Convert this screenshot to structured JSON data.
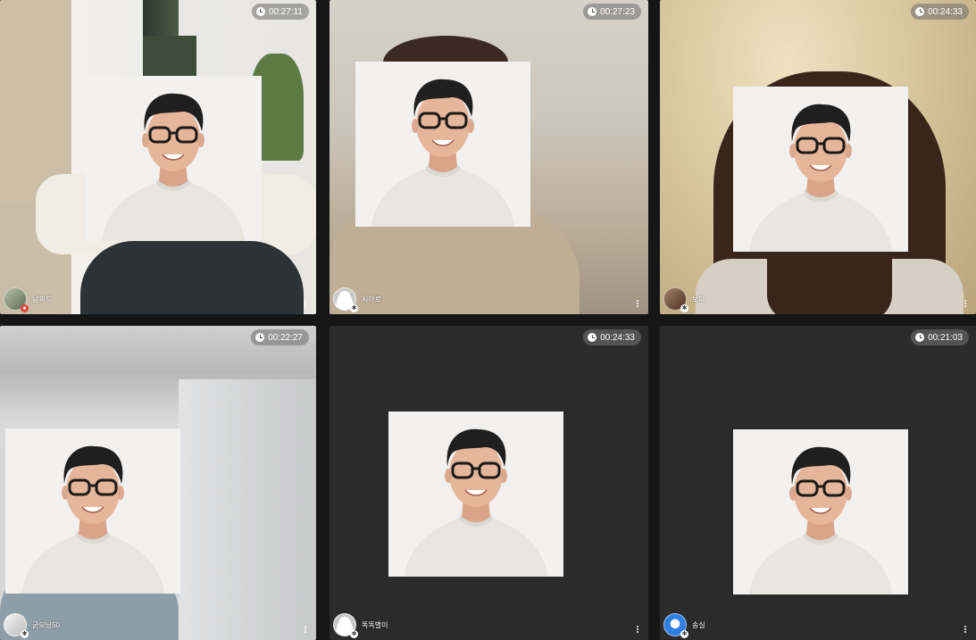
{
  "tiles": [
    {
      "id": "tile-1",
      "timer": "00:27:11",
      "name": "탐짜드",
      "avatar_icon": "user-photo-icon"
    },
    {
      "id": "tile-2",
      "timer": "00:27:23",
      "name": "시아로",
      "avatar_icon": "default-user-icon"
    },
    {
      "id": "tile-3",
      "timer": "00:24:33",
      "name": "보다",
      "avatar_icon": "user-photo-icon"
    },
    {
      "id": "tile-4",
      "timer": "00:22:27",
      "name": "굳모닝50",
      "avatar_icon": "user-photo-icon"
    },
    {
      "id": "tile-5",
      "timer": "00:24:33",
      "name": "똑똑별이",
      "avatar_icon": "default-user-icon"
    },
    {
      "id": "tile-6",
      "timer": "00:21:03",
      "name": "송실",
      "avatar_icon": "user-photo-icon"
    }
  ],
  "colors": {
    "empty_tile_bg": "#2b2b2b",
    "timer_pill": "#6e6e6e",
    "avatar_blue": "#2f7fe0"
  }
}
